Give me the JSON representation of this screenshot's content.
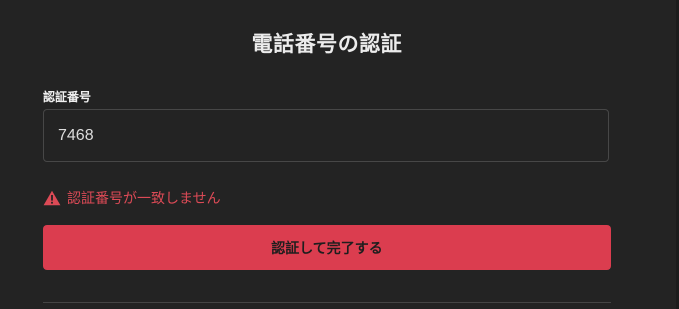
{
  "form": {
    "title": "電話番号の認証",
    "field_label": "認証番号",
    "code_value": "7468",
    "error_icon": "warning-triangle-icon",
    "error_message": "認証番号が一致しません",
    "submit_label": "認証して完了する"
  },
  "colors": {
    "background": "#232323",
    "accent": "#db3d4f",
    "error": "#dc4a56",
    "border": "#474747"
  }
}
